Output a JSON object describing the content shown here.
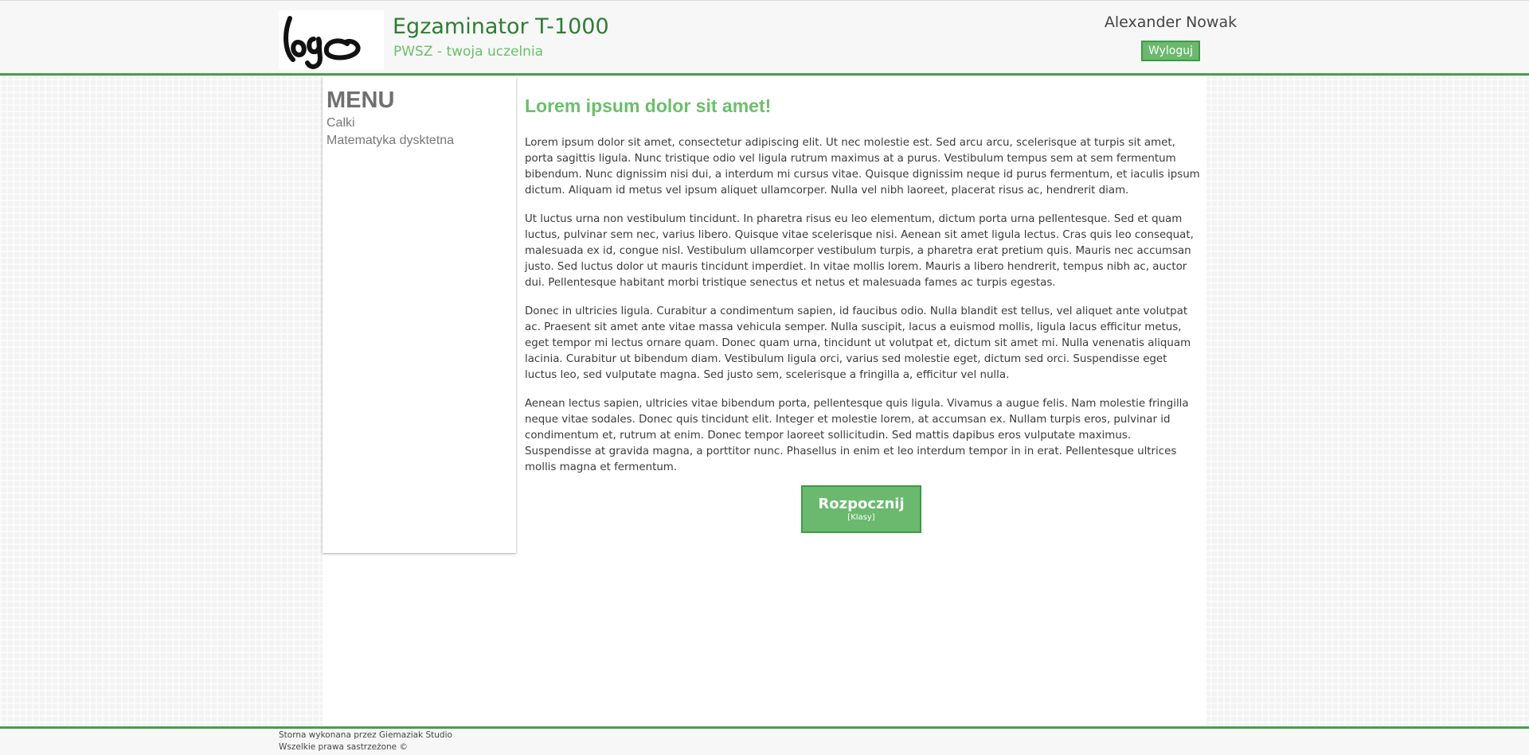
{
  "header": {
    "logo_text": "logo",
    "title": "Egzaminator T-1000",
    "subtitle": "PWSZ - twoja uczelnia",
    "user_name": "Alexander Nowak",
    "logout_label": "Wyloguj"
  },
  "menu": {
    "title": "MENU",
    "items": [
      {
        "label": "Calki"
      },
      {
        "label": "Matematyka dysktetna"
      }
    ]
  },
  "content": {
    "title": "Lorem ipsum dolor sit amet!",
    "paragraphs": [
      "Lorem ipsum dolor sit amet, consectetur adipiscing elit. Ut nec molestie est. Sed arcu arcu, scelerisque at turpis sit amet, porta sagittis ligula. Nunc tristique odio vel ligula rutrum maximus at a purus. Vestibulum tempus sem at sem fermentum bibendum. Nunc dignissim nisi dui, a interdum mi cursus vitae. Quisque dignissim neque id purus fermentum, et iaculis ipsum dictum. Aliquam id metus vel ipsum aliquet ullamcorper. Nulla vel nibh laoreet, placerat risus ac, hendrerit diam.",
      "Ut luctus urna non vestibulum tincidunt. In pharetra risus eu leo elementum, dictum porta urna pellentesque. Sed et quam luctus, pulvinar sem nec, varius libero. Quisque vitae scelerisque nisi. Aenean sit amet ligula lectus. Cras quis leo consequat, malesuada ex id, congue nisl. Vestibulum ullamcorper vestibulum turpis, a pharetra erat pretium quis. Mauris nec accumsan justo. Sed luctus dolor ut mauris tincidunt imperdiet. In vitae mollis lorem. Mauris a libero hendrerit, tempus nibh ac, auctor dui. Pellentesque habitant morbi tristique senectus et netus et malesuada fames ac turpis egestas.",
      "Donec in ultricies ligula. Curabitur a condimentum sapien, id faucibus odio. Nulla blandit est tellus, vel aliquet ante volutpat ac. Praesent sit amet ante vitae massa vehicula semper. Nulla suscipit, lacus a euismod mollis, ligula lacus efficitur metus, eget tempor mi lectus ornare quam. Donec quam urna, tincidunt ut volutpat et, dictum sit amet mi. Nulla venenatis aliquam lacinia. Curabitur ut bibendum diam. Vestibulum ligula orci, varius sed molestie eget, dictum sed orci. Suspendisse eget luctus leo, sed vulputate magna. Sed justo sem, scelerisque a fringilla a, efficitur vel nulla.",
      "Aenean lectus sapien, ultricies vitae bibendum porta, pellentesque quis ligula. Vivamus a augue felis. Nam molestie fringilla neque vitae sodales. Donec quis tincidunt elit. Integer et molestie lorem, at accumsan ex. Nullam turpis eros, pulvinar id condimentum et, rutrum at enim. Donec tempor laoreet sollicitudin. Sed mattis dapibus eros vulputate maximus. Suspendisse at gravida magna, a porttitor nunc. Phasellus in enim et leo interdum tempor in in erat. Pellentesque ultrices mollis magna et fermentum."
    ],
    "start_button": {
      "label": "Rozpocznij",
      "sublabel": "[Klasy]"
    }
  },
  "footer": {
    "line1": "Storna wykonana przez Giemaziak Studio",
    "line2": "Wszelkie prawa sastrzeżone ©"
  },
  "colors": {
    "accent_green": "#43a047",
    "title_green": "#2e7d32",
    "light_green": "#6bbf6b",
    "button_green": "#6ab96e"
  }
}
